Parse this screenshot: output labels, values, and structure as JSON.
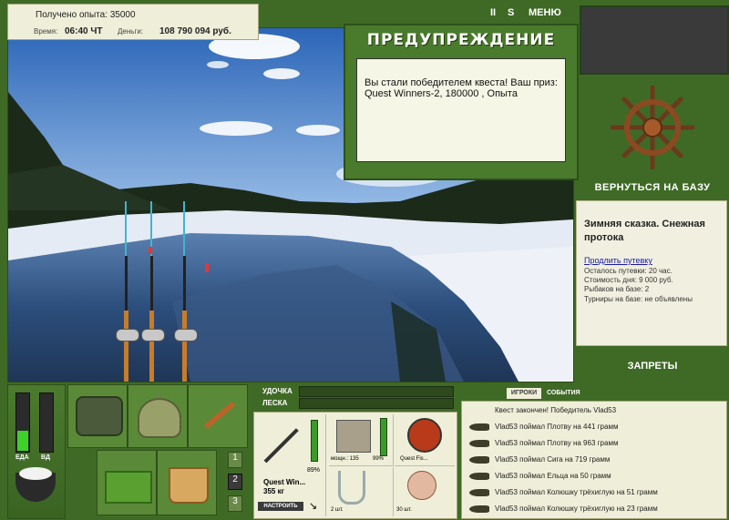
{
  "header": {
    "exp_label": "Получено опыта: 35000",
    "time_label": "Время:",
    "time_value": "06:40 ЧТ",
    "money_label": "Деньги:",
    "money_value": "108 790 094 руб.",
    "pause": "II",
    "s_button": "S",
    "menu": "МЕНЮ"
  },
  "warning": {
    "title": "ПРЕДУПРЕЖДЕНИЕ",
    "message": "Вы стали победителем квеста! Ваш приз: Quest Winners-2, 180000 , Опыта"
  },
  "right": {
    "back_button": "ВЕРНУТЬСЯ НА БАЗУ",
    "base_name": "Зимняя сказка. Снежная протока",
    "extend_link": "Продлить путевку",
    "remaining": "Осталось путевки: 20 час.",
    "day_cost": "Стоимость дня: 9 000 руб.",
    "fishers": "Рыбаков на базе: 2",
    "tournaments": "Турниры на базе: не объявлены",
    "bans": "ЗАПРЕТЫ"
  },
  "gauges": {
    "food_label": "ЕДА",
    "food_level": 0.35,
    "vd_label": "ВД",
    "vd_level": 0
  },
  "pages": [
    "1",
    "2",
    "3"
  ],
  "gear": {
    "rod_label": "УДОЧКА",
    "line_label": "ЛЕСКА",
    "rod_percent": "89%",
    "rod_name": "Quest Win...",
    "rod_weight": "355 кг",
    "setup": "НАСТРОИТЬ",
    "reel_power": "мощн.: 135",
    "reel_percent": "99%",
    "line_name": "Quest Fis...",
    "hook_count": "2 шт.",
    "bait_count": "30 шт."
  },
  "log": {
    "tab_players": "ИГРОКИ",
    "tab_events": "СОБЫТИЯ",
    "rows": [
      "Квест закончен! Победитель Vlad53",
      "Vlad53 поймал Плотву на 441 грамм",
      "Vlad53 поймал Плотву на 963 грамм",
      "Vlad53 поймал Сига на 719 грамм",
      "Vlad53 поймал Ельца на 50 грамм",
      "Vlad53 поймал Колюшку трёхиглую на 51 грамм",
      "Vlad53 поймал Колюшку трёхиглую на 23 грамм"
    ]
  }
}
